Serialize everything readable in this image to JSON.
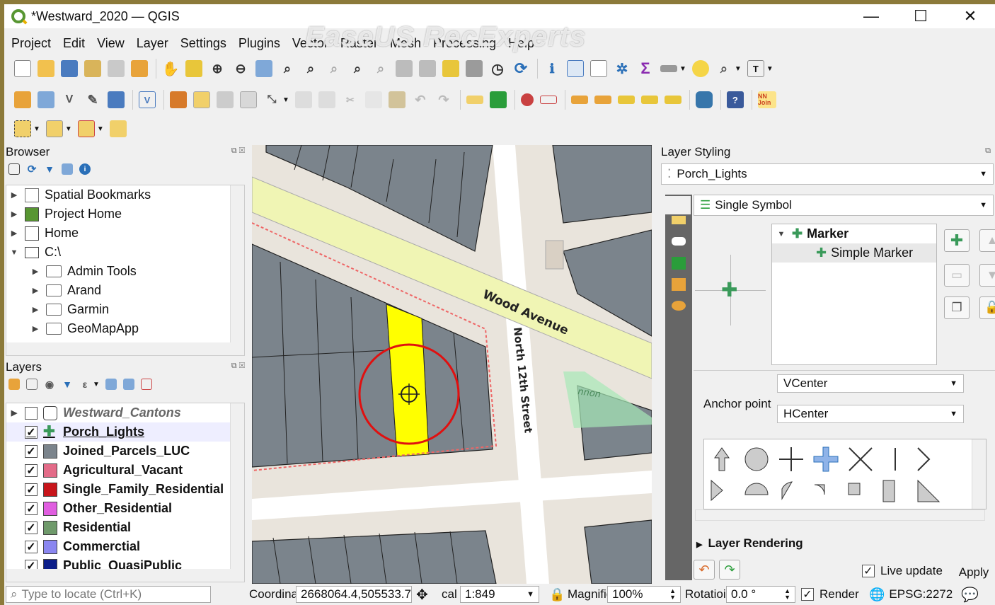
{
  "window": {
    "title": "*Westward_2020 — QGIS",
    "minimize": "—",
    "maximize": "☐",
    "close": "✕"
  },
  "watermark": "EaseUS RecExperts",
  "menu": [
    "Project",
    "Edit",
    "View",
    "Layer",
    "Settings",
    "Plugins",
    "Vector",
    "Raster",
    "Mesh",
    "Processing",
    "Help"
  ],
  "toolbar": {
    "join_label": "NN Join"
  },
  "browser": {
    "title": "Browser",
    "items": [
      {
        "label": "Spatial Bookmarks",
        "icon": "bookmark-icon"
      },
      {
        "label": "Project Home",
        "icon": "project-home-icon"
      },
      {
        "label": "Home",
        "icon": "home-icon"
      },
      {
        "label": "C:\\",
        "icon": "drive-icon"
      },
      {
        "label": "Admin Tools",
        "icon": "folder-icon"
      },
      {
        "label": "Arand",
        "icon": "folder-icon"
      },
      {
        "label": "Garmin",
        "icon": "folder-icon"
      },
      {
        "label": "GeoMapApp",
        "icon": "folder-icon"
      }
    ]
  },
  "layers": {
    "title": "Layers",
    "items": [
      {
        "label": "Westward_Cantons",
        "checked": false,
        "color": "#ffffff"
      },
      {
        "label": "Porch_Lights",
        "checked": true,
        "color": "#3a9a5a"
      },
      {
        "label": "Joined_Parcels_LUC",
        "checked": true,
        "color": "#7b848c"
      },
      {
        "label": "Agricultural_Vacant",
        "checked": true,
        "color": "#e36b88"
      },
      {
        "label": "Single_Family_Residential",
        "checked": true,
        "color": "#c8151b"
      },
      {
        "label": "Other_Residential",
        "checked": true,
        "color": "#e05ee0"
      },
      {
        "label": "Residential",
        "checked": true,
        "color": "#6f9a6b"
      },
      {
        "label": "Commerctial",
        "checked": true,
        "color": "#8a86f0"
      },
      {
        "label": "Public_QuasiPublic",
        "checked": true,
        "color": "#0d1f8a"
      }
    ]
  },
  "map": {
    "street1": "Wood Avenue",
    "street2": "North 12th Street",
    "park_label": "nnon"
  },
  "styling": {
    "title": "Layer Styling",
    "layer": "Porch_Lights",
    "renderer": "Single Symbol",
    "tree_marker": "Marker",
    "tree_simple": "Simple Marker",
    "anchor_label": "Anchor point",
    "vanchor": "VCenter",
    "hanchor": "HCenter",
    "layer_rendering": "Layer Rendering",
    "live_update": "Live update",
    "apply": "Apply"
  },
  "status": {
    "locate_placeholder": "Type to locate (Ctrl+K)",
    "coord_label": "Coordinat",
    "coord_value": "2668064.4,505533.7",
    "scale_label": "cal",
    "scale_value": "1:849",
    "mag_label": "Magnifie",
    "mag_value": "100%",
    "rot_label": "Rotatioi",
    "rot_value": "0.0 °",
    "render_label": "Render",
    "crs": "EPSG:2272"
  },
  "colors": {
    "accent": "#589632",
    "parcel": "#7b848c",
    "highlight": "#ffff00",
    "selection_ring": "#e01010",
    "road": "#f0f5b4"
  }
}
